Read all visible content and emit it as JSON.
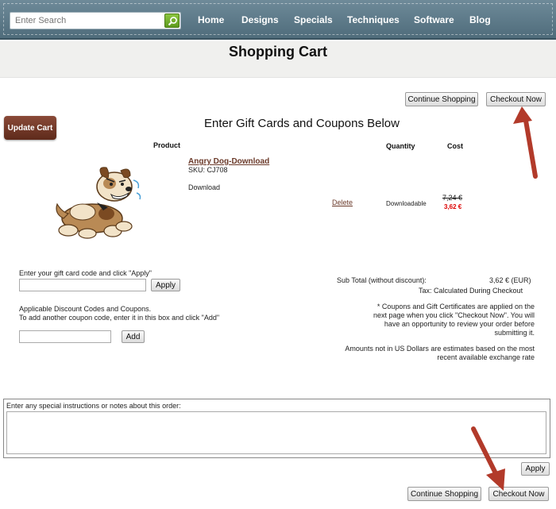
{
  "header": {
    "search_placeholder": "Enter Search",
    "nav": [
      "Home",
      "Designs",
      "Specials",
      "Techniques",
      "Software",
      "Blog"
    ]
  },
  "page": {
    "title": "Shopping Cart"
  },
  "top_buttons": {
    "continue": "Continue Shopping",
    "checkout": "Checkout Now"
  },
  "cart": {
    "update_label": "Update Cart",
    "gift_heading": "Enter Gift Cards and Coupons Below",
    "columns": {
      "product": "Product",
      "quantity": "Quantity",
      "cost": "Cost"
    },
    "item": {
      "name": "Angry Dog-Download",
      "sku": "SKU: CJ708",
      "type": "Download",
      "delete": "Delete",
      "quantity": "Downloadable",
      "old_price": "7,24 €",
      "new_price": "3,62 €"
    }
  },
  "gift": {
    "label": "Enter your gift card code and click \"Apply\"",
    "apply": "Apply",
    "discount_line1": "Applicable Discount Codes and Coupons.",
    "discount_line2": "To add another coupon code, enter it in this box and click \"Add\"",
    "add": "Add"
  },
  "summary": {
    "subtotal_label": "Sub Total (without discount):",
    "subtotal_value": "3,62 € (EUR)",
    "tax": "Tax:  Calculated During Checkout",
    "note1": "* Coupons and Gift Certificates are applied on the",
    "note2": "next page when you click \"Checkout Now\". You will",
    "note3": "have an opportunity to review your order before",
    "note4": "submitting it.",
    "usd1": "Amounts not in US Dollars are estimates based on the most",
    "usd2": "recent available exchange rate"
  },
  "notes": {
    "label": "Enter any special instructions or notes about this order:",
    "apply": "Apply"
  },
  "bottom_buttons": {
    "continue": "Continue Shopping",
    "checkout": "Checkout Now"
  },
  "colors": {
    "header": "#56717f",
    "brand_brown": "#6b3a2a",
    "arrow": "#b23a2a",
    "sale_red": "#dd0000"
  }
}
